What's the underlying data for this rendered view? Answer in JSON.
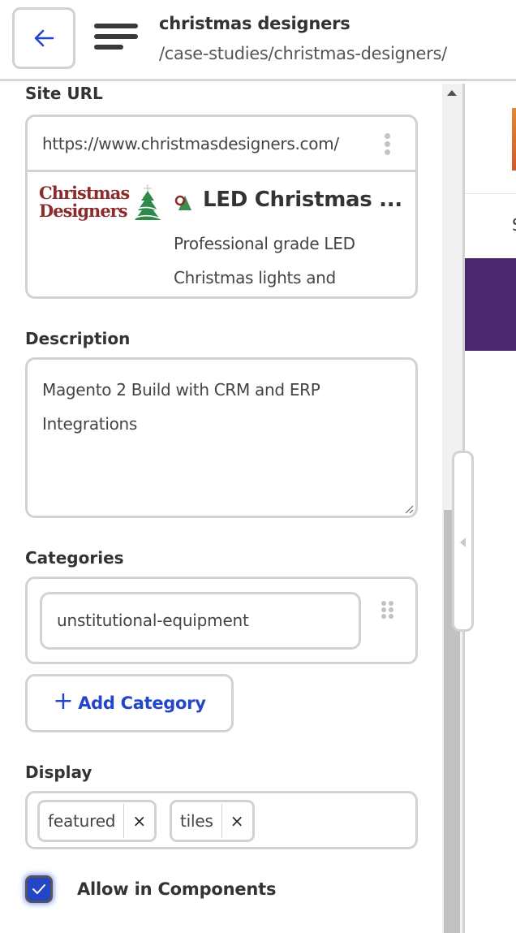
{
  "header": {
    "title": "christmas designers",
    "path": "/case-studies/christmas-designers/",
    "back_icon": "arrow-left-icon",
    "menu_icon": "menu-icon"
  },
  "site_url": {
    "label": "Site URL",
    "value": "https://www.christmasdesigners.com/",
    "more_icon": "kebab-vertical-icon",
    "preview": {
      "logo_line1": "Christmas",
      "logo_line2": "Designers",
      "title": "LED Christmas ...",
      "description": "Professional grade LED Christmas lights and"
    }
  },
  "description": {
    "label": "Description",
    "value": "Magento 2 Build with CRM and ERP Integrations"
  },
  "categories": {
    "label": "Categories",
    "items": [
      {
        "value": "unstitutional-equipment"
      }
    ],
    "add_button": "Add Category",
    "add_icon": "plus-icon"
  },
  "display": {
    "label": "Display",
    "chips": [
      {
        "label": "featured",
        "remove": "×"
      },
      {
        "label": "tiles",
        "remove": "×"
      }
    ]
  },
  "allow_components": {
    "label": "Allow in Components",
    "checked": true
  },
  "right_pane": {
    "partial_text": "S"
  },
  "colors": {
    "accent": "#2346c8",
    "border": "#d2d2d2",
    "text": "#333333",
    "preview_purple": "#4b286d"
  }
}
